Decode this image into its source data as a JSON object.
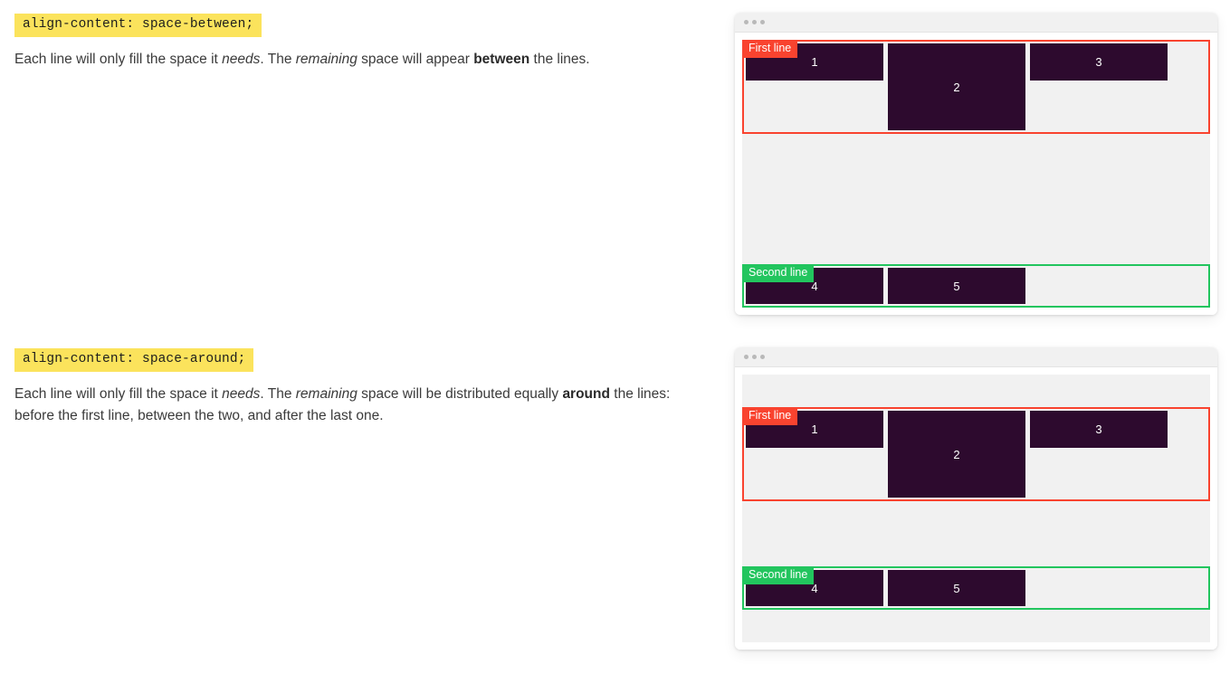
{
  "page": {
    "background": "#ffffff",
    "item_color": "#2d0a2e",
    "first_line_color": "#f9432f",
    "second_line_color": "#22c55e",
    "code_highlight_color": "#fbe35c"
  },
  "sections": [
    {
      "code_label": "align-content: space-between;",
      "description": {
        "part1": "Each line will only fill the space it ",
        "em1": "needs",
        "part2": ". The ",
        "em2": "remaining",
        "part3": " space will appear ",
        "strong1": "between",
        "part4": " the lines."
      }
    },
    {
      "code_label": "align-content: space-around;",
      "description": {
        "part1": "Each line will only fill the space it ",
        "em1": "needs",
        "part2": ". The ",
        "em2": "remaining",
        "part3": " space will be distributed equally ",
        "strong1": "around",
        "part4": " the lines: before the first line, between the two, and after the last one."
      }
    }
  ],
  "demos": [
    {
      "mode": "space-between",
      "lines": [
        {
          "badge": "First line",
          "items": [
            "1",
            "2",
            "3"
          ]
        },
        {
          "badge": "Second line",
          "items": [
            "4",
            "5"
          ]
        }
      ]
    },
    {
      "mode": "space-around",
      "lines": [
        {
          "badge": "First line",
          "items": [
            "1",
            "2",
            "3"
          ]
        },
        {
          "badge": "Second line",
          "items": [
            "4",
            "5"
          ]
        }
      ]
    }
  ]
}
